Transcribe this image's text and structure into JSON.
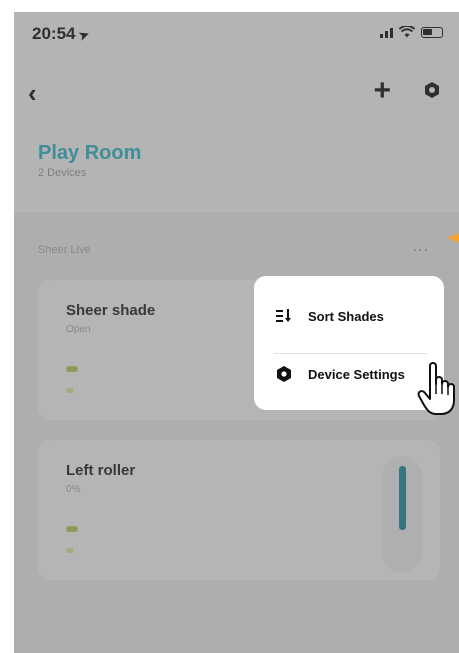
{
  "status_bar": {
    "time": "20:54"
  },
  "room": {
    "title": "Play Room",
    "subtitle": "2 Devices"
  },
  "group": {
    "label": "Sheer Live",
    "more": "..."
  },
  "cards": [
    {
      "title": "Sheer shade",
      "status": "Open"
    },
    {
      "title": "Left roller",
      "status": "0%"
    }
  ],
  "menu": {
    "items": [
      {
        "label": "Sort Shades",
        "icon": "sort-icon"
      },
      {
        "label": "Device Settings",
        "icon": "hexagon-settings-icon"
      }
    ]
  },
  "colors": {
    "accent": "#2bb4c4",
    "slider": "#1b8aa1",
    "callout_arrow": "#f1a233"
  }
}
